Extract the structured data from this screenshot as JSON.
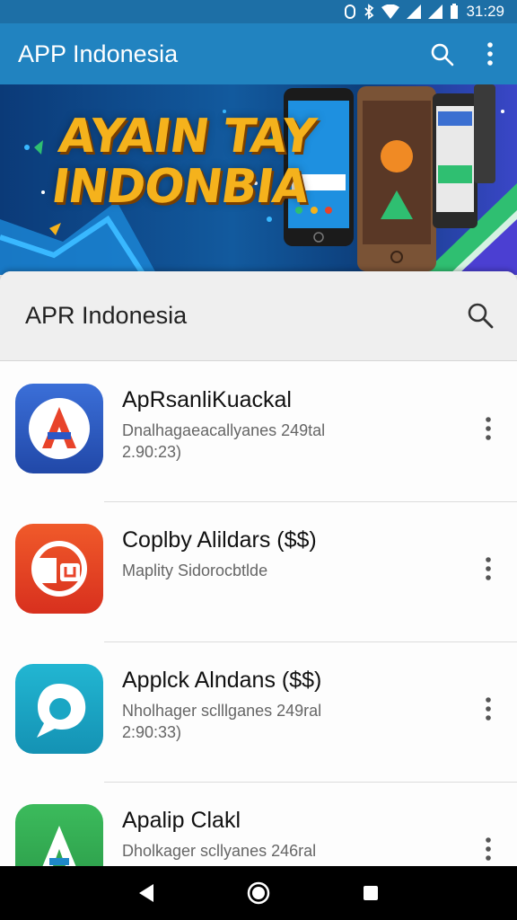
{
  "status_bar": {
    "time": "31:29"
  },
  "app_bar": {
    "title": "APP Indonesia"
  },
  "banner": {
    "line1": "AYAIN TAY",
    "line2": "INDONBIA"
  },
  "sheet": {
    "title": "APR Indonesia"
  },
  "apps": [
    {
      "name": "ApRsanliKuackal",
      "sub1": "Dnalhagaeacallyanes 249tal",
      "sub2": "2.90:23)",
      "icon": "orange-a-icon",
      "bg": "#2f5fc4"
    },
    {
      "name": "Coplby Alildars ($$)",
      "sub1": "Maplity Sidorocbtlde",
      "sub2": "",
      "icon": "red-cup-icon",
      "bg": "#e8432a"
    },
    {
      "name": "Applck Alndans ($$)",
      "sub1": "Nholhager sclllganes 249ral",
      "sub2": "2:90:33)",
      "icon": "speech-bubble-icon",
      "bg": "#1aa6c4"
    },
    {
      "name": "Apalip Clakl",
      "sub1": "Dholkager scllyanes 246ral",
      "sub2": "",
      "icon": "green-a-icon",
      "bg": "#34a853"
    }
  ],
  "colors": {
    "app_bar": "#2183c0",
    "status_bar": "#1d6fa6",
    "banner_text": "#f5b21c"
  }
}
